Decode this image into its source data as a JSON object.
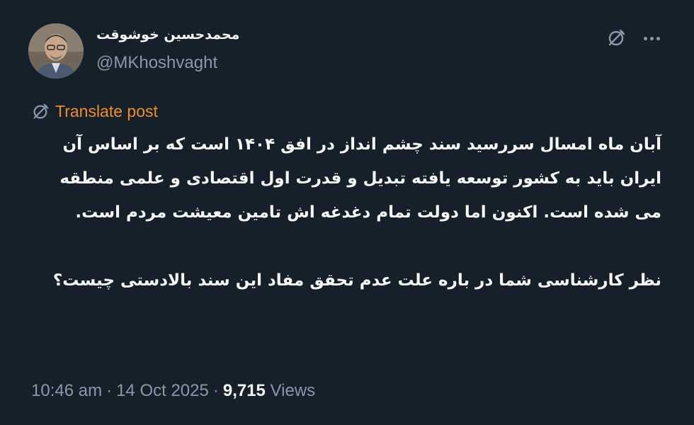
{
  "author": {
    "name": "محمدحسین خوشوقت",
    "handle": "@MKhoshvaght"
  },
  "icons": {
    "translate": "translate-icon",
    "more": "more-icon"
  },
  "translate": {
    "label": "Translate post"
  },
  "post": {
    "paragraph1": "آبان ماه امسال سررسید سند چشم انداز در افق ۱۴۰۴ است که بر اساس آن ایران باید به کشور توسعه یافته تبدیل و قدرت اول اقتصادی و علمی منطقه می شده است. اکنون اما دولت تمام دغدغه اش تامین معیشت مردم است.",
    "paragraph2": "نظر کارشناسی شما در باره علت عدم تحقق مفاد این سند بالادستی چیست؟"
  },
  "meta": {
    "time": "10:46 am",
    "date": "14 Oct 2025",
    "separator": "·",
    "views_count": "9,715",
    "views_label": "Views"
  },
  "colors": {
    "background": "#15202b",
    "text": "#f7f9f9",
    "secondary": "#8b98a5",
    "translate_accent": "#f28c28"
  }
}
